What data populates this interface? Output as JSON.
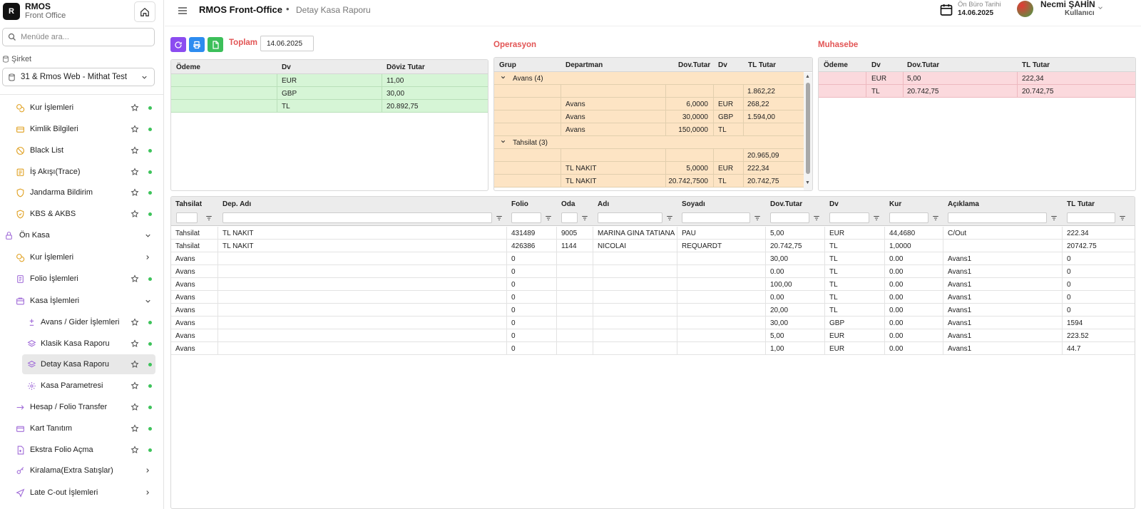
{
  "brand": {
    "title": "RMOS",
    "subtitle": "Front Office",
    "logo": "R"
  },
  "search": {
    "placeholder": "Menüde ara..."
  },
  "company": {
    "label": "Şirket",
    "value": "31 & Rmos Web - Mithat Test"
  },
  "menu": [
    {
      "label": "Kur İşlemleri",
      "icon": "coins-icon",
      "star": true
    },
    {
      "label": "Kimlik Bilgileri",
      "icon": "id-card-icon",
      "star": true
    },
    {
      "label": "Black List",
      "icon": "ban-icon",
      "star": true
    },
    {
      "label": "İş Akışı(Trace)",
      "icon": "workflow-icon",
      "star": true
    },
    {
      "label": "Jandarma Bildirim",
      "icon": "shield-icon",
      "star": true
    },
    {
      "label": "KBS & AKBS",
      "icon": "shield-check-icon",
      "star": true
    },
    {
      "label": "Ön Kasa",
      "icon": "lock-icon",
      "expanded": true
    },
    {
      "label": "Kur İşlemleri",
      "icon": "coins-icon",
      "arrow": true
    },
    {
      "label": "Folio İşlemleri",
      "icon": "folio-icon",
      "star": true
    },
    {
      "label": "Kasa İşlemleri",
      "icon": "cashbox-icon",
      "expanded": true
    },
    {
      "label": "Avans / Gider İşlemleri",
      "icon": "plus-minus-icon",
      "star": true
    },
    {
      "label": "Klasik Kasa Raporu",
      "icon": "layers-icon",
      "star": true
    },
    {
      "label": "Detay Kasa Raporu",
      "icon": "layers-icon",
      "star": true,
      "active": true
    },
    {
      "label": "Kasa Parametresi",
      "icon": "gear-icon",
      "star": true
    },
    {
      "label": "Hesap / Folio Transfer",
      "icon": "arrow-right-icon",
      "star": true
    },
    {
      "label": "Kart Tanıtım",
      "icon": "card-icon",
      "star": true
    },
    {
      "label": "Ekstra Folio Açma",
      "icon": "file-plus-icon",
      "star": true
    },
    {
      "label": "Kiralama(Extra Satışlar)",
      "icon": "key-icon",
      "arrow": true
    },
    {
      "label": "Late C-out İşlemleri",
      "icon": "plane-icon",
      "arrow": true
    }
  ],
  "topbar": {
    "app": "RMOS Front-Office",
    "bullet": "•",
    "page": "Detay Kasa Raporu",
    "onburo_label": "Ön Büro Tarihi",
    "onburo_date": "14.06.2025",
    "user_name": "Necmi ŞAHİN",
    "user_role": "Kullanıcı"
  },
  "toplam": {
    "title": "Toplam",
    "date": "14.06.2025",
    "headers": [
      "Ödeme",
      "Dv",
      "Döviz Tutar"
    ],
    "rows": [
      [
        "",
        "EUR",
        "11,00"
      ],
      [
        "",
        "GBP",
        "30,00"
      ],
      [
        "",
        "TL",
        "20.892,75"
      ]
    ]
  },
  "operasyon": {
    "title": "Operasyon",
    "headers": [
      "Grup",
      "Departman",
      "Dov.Tutar",
      "Dv",
      "TL Tutar"
    ],
    "rows": [
      {
        "group": "Avans (4)",
        "dep": "",
        "dov": "",
        "dv": "",
        "tl": "",
        "is_group": true
      },
      {
        "group": "",
        "dep": "",
        "dov": "",
        "dv": "",
        "tl": "1.862,22"
      },
      {
        "group": "",
        "dep": "Avans",
        "dov": "6,0000",
        "dv": "EUR",
        "tl": "268,22"
      },
      {
        "group": "",
        "dep": "Avans",
        "dov": "30,0000",
        "dv": "GBP",
        "tl": "1.594,00"
      },
      {
        "group": "",
        "dep": "Avans",
        "dov": "150,0000",
        "dv": "TL",
        "tl": ""
      },
      {
        "group": "Tahsilat (3)",
        "dep": "",
        "dov": "",
        "dv": "",
        "tl": "",
        "is_group": true
      },
      {
        "group": "",
        "dep": "",
        "dov": "",
        "dv": "",
        "tl": "20.965,09"
      },
      {
        "group": "",
        "dep": "TL NAKIT",
        "dov": "5,0000",
        "dv": "EUR",
        "tl": "222,34"
      },
      {
        "group": "",
        "dep": "TL NAKIT",
        "dov": "20.742,7500",
        "dv": "TL",
        "tl": "20.742,75"
      }
    ]
  },
  "muhasebe": {
    "title": "Muhasebe",
    "headers": [
      "Ödeme",
      "Dv",
      "Dov.Tutar",
      "TL Tutar"
    ],
    "rows": [
      [
        "",
        "EUR",
        "5,00",
        "222,34"
      ],
      [
        "",
        "TL",
        "20.742,75",
        "20.742,75"
      ]
    ]
  },
  "detail": {
    "headers": [
      "Tahsilat",
      "Dep. Adı",
      "Folio",
      "Oda",
      "Adı",
      "Soyadı",
      "Dov.Tutar",
      "Dv",
      "Kur",
      "Açıklama",
      "TL Tutar"
    ],
    "rows": [
      [
        "Tahsilat",
        "TL NAKIT",
        "431489",
        "9005",
        "MARINA GINA TATIANA",
        "PAU",
        "5,00",
        "EUR",
        "44,4680",
        "C/Out",
        "222.34"
      ],
      [
        "Tahsilat",
        "TL NAKIT",
        "426386",
        "1144",
        "NICOLAI",
        "REQUARDT",
        "20.742,75",
        "TL",
        "1,0000",
        "",
        "20742.75"
      ],
      [
        "Avans",
        "",
        "0",
        "",
        "",
        "",
        "30,00",
        "TL",
        "0.00",
        "Avans1",
        "0"
      ],
      [
        "Avans",
        "",
        "0",
        "",
        "",
        "",
        "0.00",
        "TL",
        "0.00",
        "Avans1",
        "0"
      ],
      [
        "Avans",
        "",
        "0",
        "",
        "",
        "",
        "100,00",
        "TL",
        "0.00",
        "Avans1",
        "0"
      ],
      [
        "Avans",
        "",
        "0",
        "",
        "",
        "",
        "0.00",
        "TL",
        "0.00",
        "Avans1",
        "0"
      ],
      [
        "Avans",
        "",
        "0",
        "",
        "",
        "",
        "20,00",
        "TL",
        "0.00",
        "Avans1",
        "0"
      ],
      [
        "Avans",
        "",
        "0",
        "",
        "",
        "",
        "30,00",
        "GBP",
        "0.00",
        "Avans1",
        "1594"
      ],
      [
        "Avans",
        "",
        "0",
        "",
        "",
        "",
        "5,00",
        "EUR",
        "0.00",
        "Avans1",
        "223.52"
      ],
      [
        "Avans",
        "",
        "0",
        "",
        "",
        "",
        "1,00",
        "EUR",
        "0.00",
        "Avans1",
        "44.7"
      ]
    ]
  }
}
